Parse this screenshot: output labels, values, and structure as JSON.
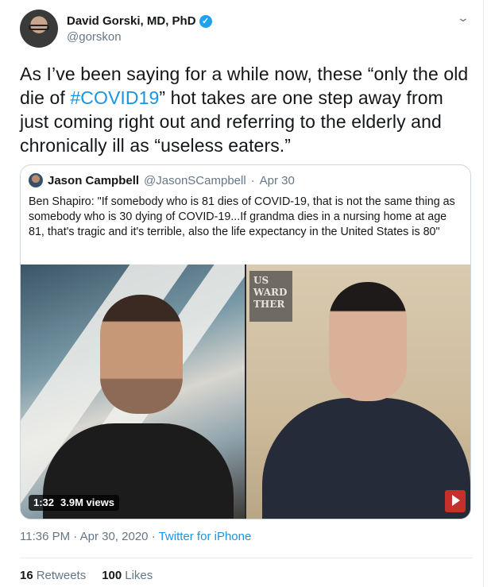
{
  "author": {
    "name": "David Gorski, MD, PhD",
    "handle": "@gorskon",
    "verified_icon": "verified-check-icon"
  },
  "tweet": {
    "text_before": "As I’ve been saying for a while now, these “only the old die of ",
    "hashtag": "#COVID19",
    "text_after": "” hot takes are one step away from just coming right out and referring to the elderly and chronically ill as “useless eaters.”"
  },
  "quote": {
    "name": "Jason Campbell",
    "handle": "@JasonSCampbell",
    "separator": "·",
    "date": "Apr 30",
    "text": "Ben Shapiro: \"If somebody who is 81 dies of COVID-19, that is not the same thing as somebody who is 30 dying of COVID-19...If grandma dies in a nursing home at age 81, that's tragic and it's terrible, also the life expectancy in the United States is 80\"",
    "video": {
      "duration": "1:32",
      "views": "3.9M views",
      "sign_text": [
        "US",
        "WARD",
        "THER"
      ]
    }
  },
  "meta": {
    "time": "11:36 PM",
    "dot": "·",
    "date": "Apr 30, 2020",
    "source": "Twitter for iPhone"
  },
  "stats": {
    "retweets_count": "16",
    "retweets_label": "Retweets",
    "likes_count": "100",
    "likes_label": "Likes"
  },
  "colors": {
    "link": "#1b95e0",
    "muted": "#657786",
    "text": "#14171a",
    "verified": "#1da1f2"
  }
}
